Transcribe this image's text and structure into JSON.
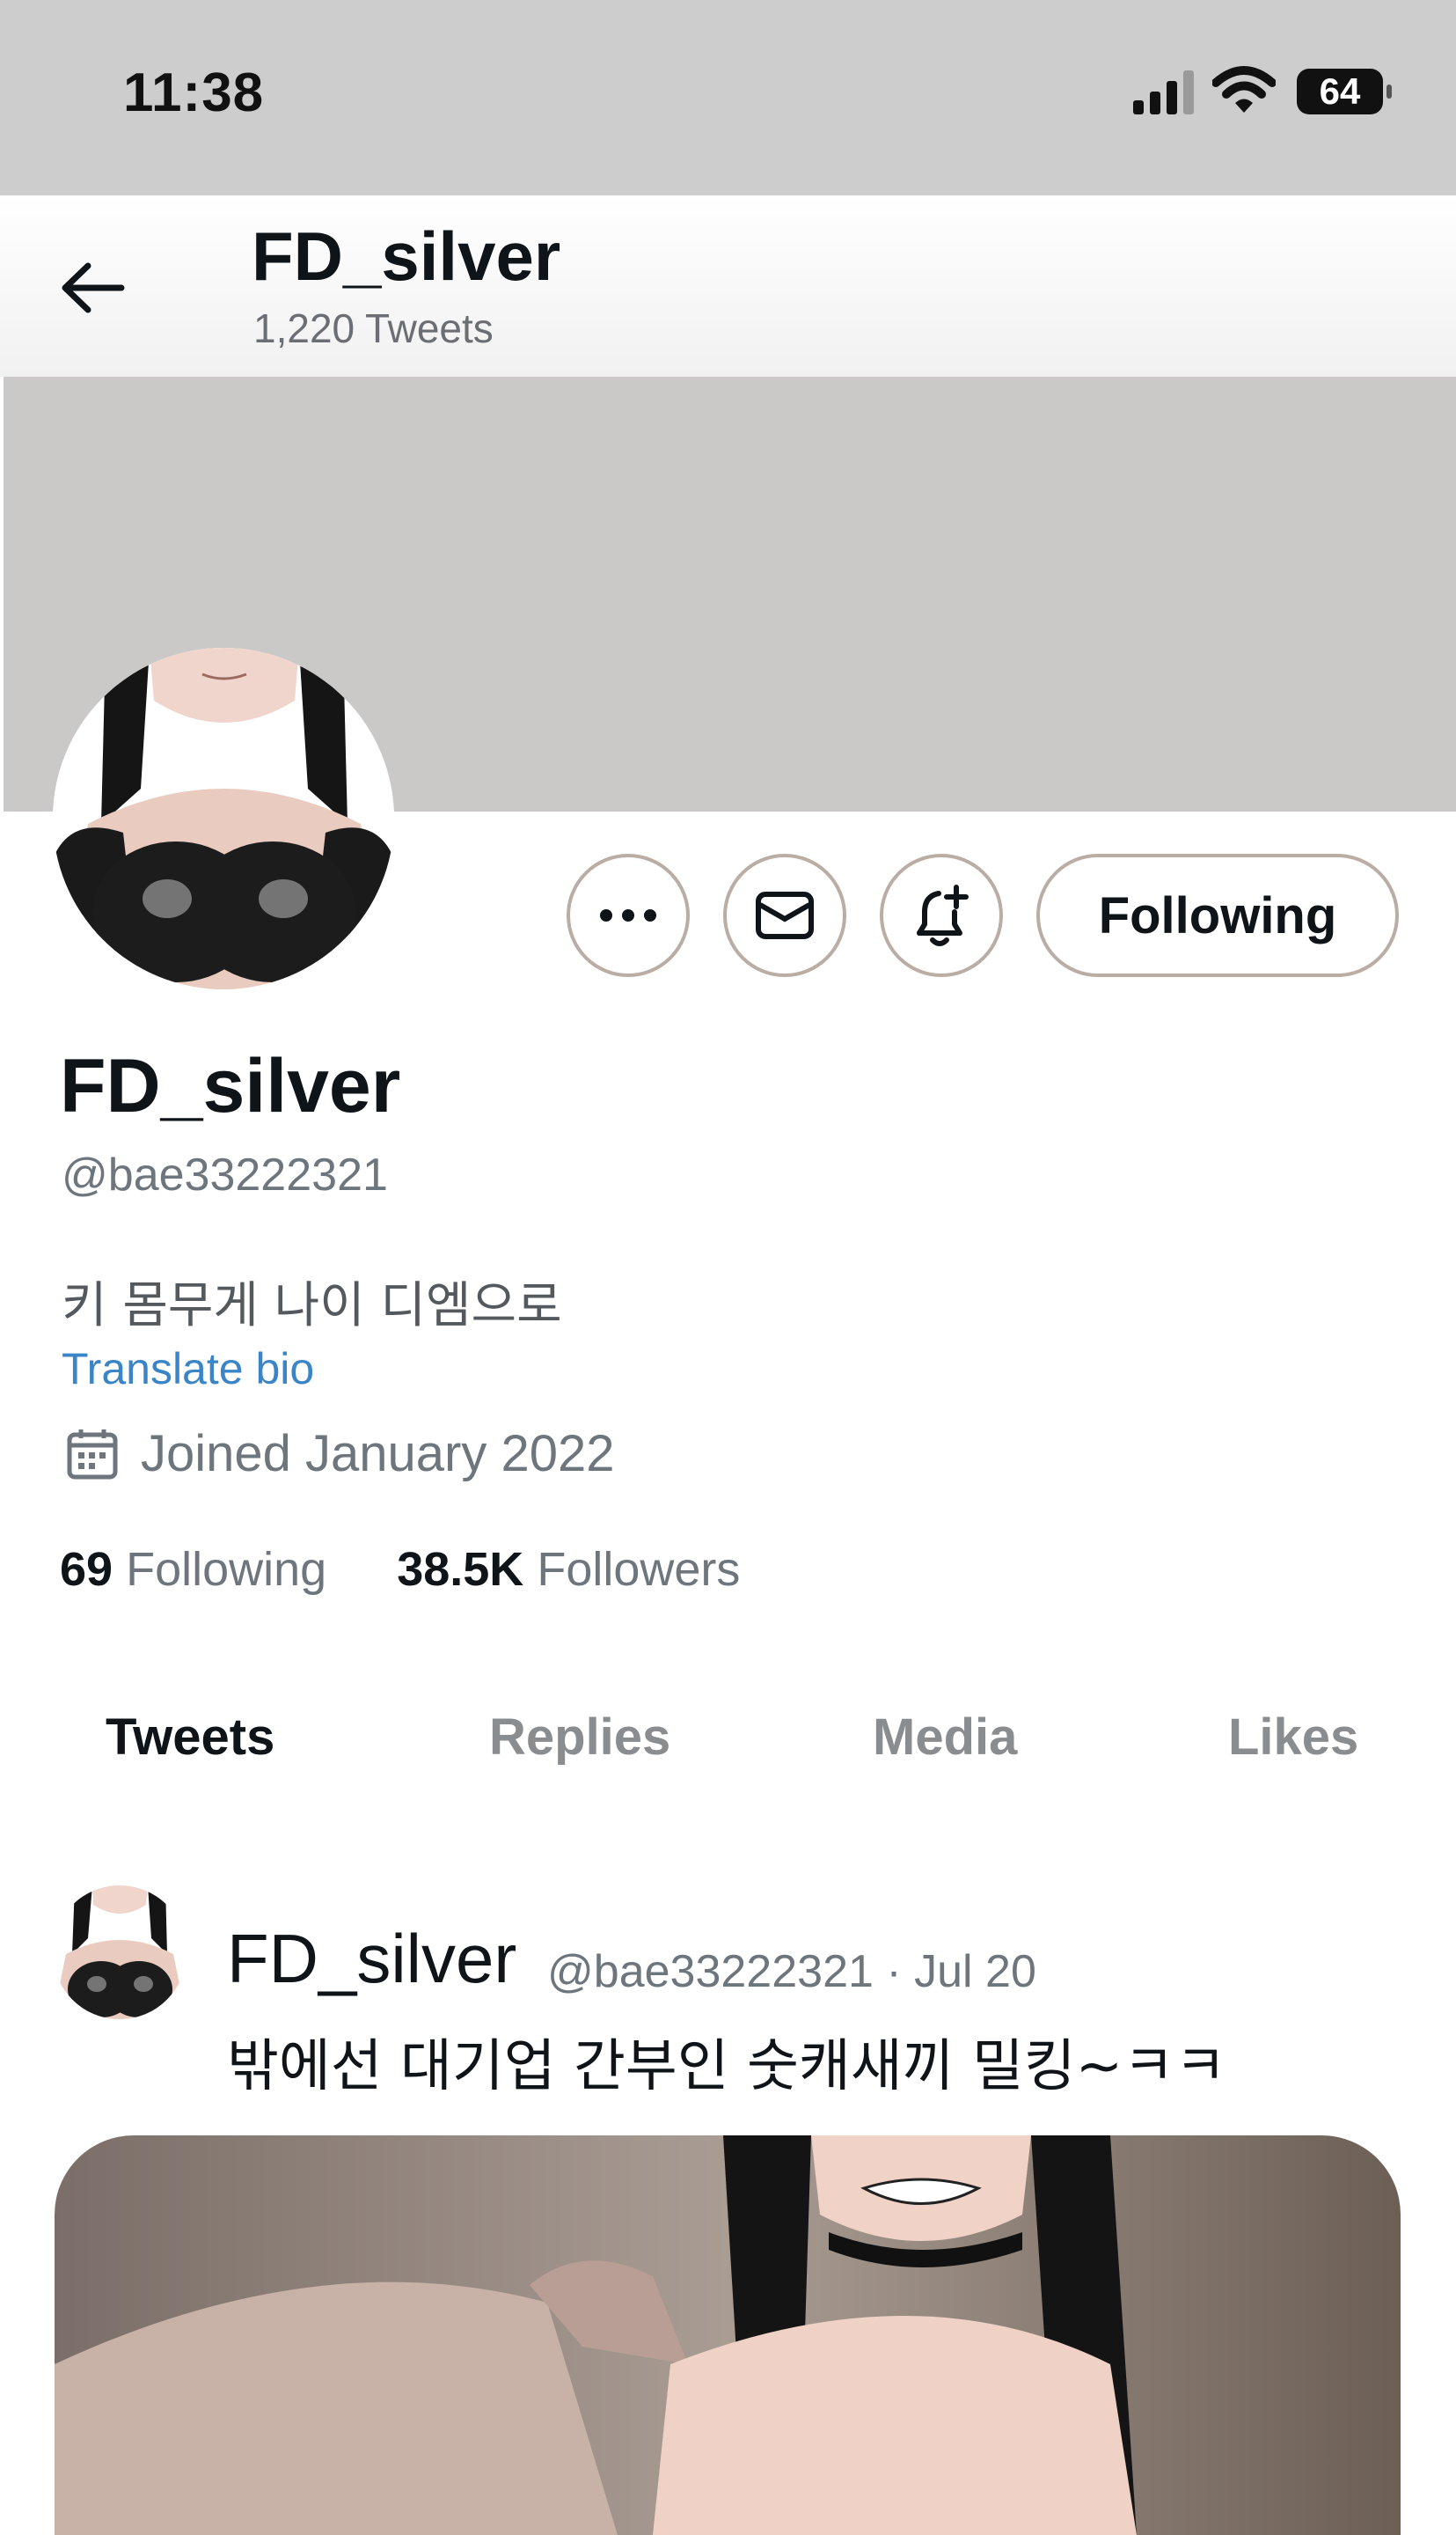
{
  "status_bar": {
    "time": "11:38",
    "battery": "64",
    "icons": [
      "signal-icon",
      "wifi-icon",
      "battery-icon"
    ]
  },
  "header": {
    "back_icon": "arrow-left-icon",
    "name": "FD_silver",
    "tweet_count": "1,220 Tweets"
  },
  "actions": {
    "more_icon": "more-icon",
    "message_icon": "mail-icon",
    "notify_icon": "bell-plus-icon",
    "following_label": "Following"
  },
  "profile": {
    "name": "FD_silver",
    "handle": "@bae33222321",
    "bio": "키 몸무게 나이 디엠으로",
    "translate_label": "Translate bio",
    "joined": "Joined January 2022",
    "joined_icon": "calendar-icon",
    "following_count": "69",
    "following_label": "Following",
    "followers_count": "38.5K",
    "followers_label": "Followers"
  },
  "tabs": [
    {
      "label": "Tweets",
      "active": true
    },
    {
      "label": "Replies",
      "active": false
    },
    {
      "label": "Media",
      "active": false
    },
    {
      "label": "Likes",
      "active": false
    }
  ],
  "tweet": {
    "name": "FD_silver",
    "handle": "@bae33222321",
    "separator": "·",
    "date": "Jul 20",
    "text": "밖에선 대기업 간부인 숫캐새끼 밀킹~ㅋㅋ"
  },
  "colors": {
    "status_bar_bg": "#cdcdcd",
    "banner": "#cbc8c8",
    "link": "#3a85c7",
    "button_border": "#b9ada4"
  }
}
